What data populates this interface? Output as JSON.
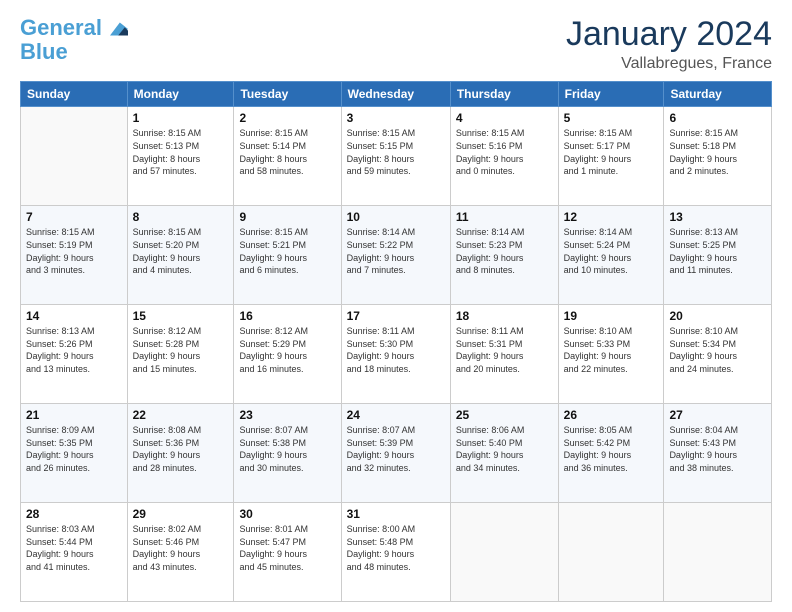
{
  "logo": {
    "line1": "General",
    "line2": "Blue"
  },
  "title": "January 2024",
  "subtitle": "Vallabregues, France",
  "header_days": [
    "Sunday",
    "Monday",
    "Tuesday",
    "Wednesday",
    "Thursday",
    "Friday",
    "Saturday"
  ],
  "weeks": [
    [
      {
        "num": "",
        "info": ""
      },
      {
        "num": "1",
        "info": "Sunrise: 8:15 AM\nSunset: 5:13 PM\nDaylight: 8 hours\nand 57 minutes."
      },
      {
        "num": "2",
        "info": "Sunrise: 8:15 AM\nSunset: 5:14 PM\nDaylight: 8 hours\nand 58 minutes."
      },
      {
        "num": "3",
        "info": "Sunrise: 8:15 AM\nSunset: 5:15 PM\nDaylight: 8 hours\nand 59 minutes."
      },
      {
        "num": "4",
        "info": "Sunrise: 8:15 AM\nSunset: 5:16 PM\nDaylight: 9 hours\nand 0 minutes."
      },
      {
        "num": "5",
        "info": "Sunrise: 8:15 AM\nSunset: 5:17 PM\nDaylight: 9 hours\nand 1 minute."
      },
      {
        "num": "6",
        "info": "Sunrise: 8:15 AM\nSunset: 5:18 PM\nDaylight: 9 hours\nand 2 minutes."
      }
    ],
    [
      {
        "num": "7",
        "info": "Sunrise: 8:15 AM\nSunset: 5:19 PM\nDaylight: 9 hours\nand 3 minutes."
      },
      {
        "num": "8",
        "info": "Sunrise: 8:15 AM\nSunset: 5:20 PM\nDaylight: 9 hours\nand 4 minutes."
      },
      {
        "num": "9",
        "info": "Sunrise: 8:15 AM\nSunset: 5:21 PM\nDaylight: 9 hours\nand 6 minutes."
      },
      {
        "num": "10",
        "info": "Sunrise: 8:14 AM\nSunset: 5:22 PM\nDaylight: 9 hours\nand 7 minutes."
      },
      {
        "num": "11",
        "info": "Sunrise: 8:14 AM\nSunset: 5:23 PM\nDaylight: 9 hours\nand 8 minutes."
      },
      {
        "num": "12",
        "info": "Sunrise: 8:14 AM\nSunset: 5:24 PM\nDaylight: 9 hours\nand 10 minutes."
      },
      {
        "num": "13",
        "info": "Sunrise: 8:13 AM\nSunset: 5:25 PM\nDaylight: 9 hours\nand 11 minutes."
      }
    ],
    [
      {
        "num": "14",
        "info": "Sunrise: 8:13 AM\nSunset: 5:26 PM\nDaylight: 9 hours\nand 13 minutes."
      },
      {
        "num": "15",
        "info": "Sunrise: 8:12 AM\nSunset: 5:28 PM\nDaylight: 9 hours\nand 15 minutes."
      },
      {
        "num": "16",
        "info": "Sunrise: 8:12 AM\nSunset: 5:29 PM\nDaylight: 9 hours\nand 16 minutes."
      },
      {
        "num": "17",
        "info": "Sunrise: 8:11 AM\nSunset: 5:30 PM\nDaylight: 9 hours\nand 18 minutes."
      },
      {
        "num": "18",
        "info": "Sunrise: 8:11 AM\nSunset: 5:31 PM\nDaylight: 9 hours\nand 20 minutes."
      },
      {
        "num": "19",
        "info": "Sunrise: 8:10 AM\nSunset: 5:33 PM\nDaylight: 9 hours\nand 22 minutes."
      },
      {
        "num": "20",
        "info": "Sunrise: 8:10 AM\nSunset: 5:34 PM\nDaylight: 9 hours\nand 24 minutes."
      }
    ],
    [
      {
        "num": "21",
        "info": "Sunrise: 8:09 AM\nSunset: 5:35 PM\nDaylight: 9 hours\nand 26 minutes."
      },
      {
        "num": "22",
        "info": "Sunrise: 8:08 AM\nSunset: 5:36 PM\nDaylight: 9 hours\nand 28 minutes."
      },
      {
        "num": "23",
        "info": "Sunrise: 8:07 AM\nSunset: 5:38 PM\nDaylight: 9 hours\nand 30 minutes."
      },
      {
        "num": "24",
        "info": "Sunrise: 8:07 AM\nSunset: 5:39 PM\nDaylight: 9 hours\nand 32 minutes."
      },
      {
        "num": "25",
        "info": "Sunrise: 8:06 AM\nSunset: 5:40 PM\nDaylight: 9 hours\nand 34 minutes."
      },
      {
        "num": "26",
        "info": "Sunrise: 8:05 AM\nSunset: 5:42 PM\nDaylight: 9 hours\nand 36 minutes."
      },
      {
        "num": "27",
        "info": "Sunrise: 8:04 AM\nSunset: 5:43 PM\nDaylight: 9 hours\nand 38 minutes."
      }
    ],
    [
      {
        "num": "28",
        "info": "Sunrise: 8:03 AM\nSunset: 5:44 PM\nDaylight: 9 hours\nand 41 minutes."
      },
      {
        "num": "29",
        "info": "Sunrise: 8:02 AM\nSunset: 5:46 PM\nDaylight: 9 hours\nand 43 minutes."
      },
      {
        "num": "30",
        "info": "Sunrise: 8:01 AM\nSunset: 5:47 PM\nDaylight: 9 hours\nand 45 minutes."
      },
      {
        "num": "31",
        "info": "Sunrise: 8:00 AM\nSunset: 5:48 PM\nDaylight: 9 hours\nand 48 minutes."
      },
      {
        "num": "",
        "info": ""
      },
      {
        "num": "",
        "info": ""
      },
      {
        "num": "",
        "info": ""
      }
    ]
  ]
}
